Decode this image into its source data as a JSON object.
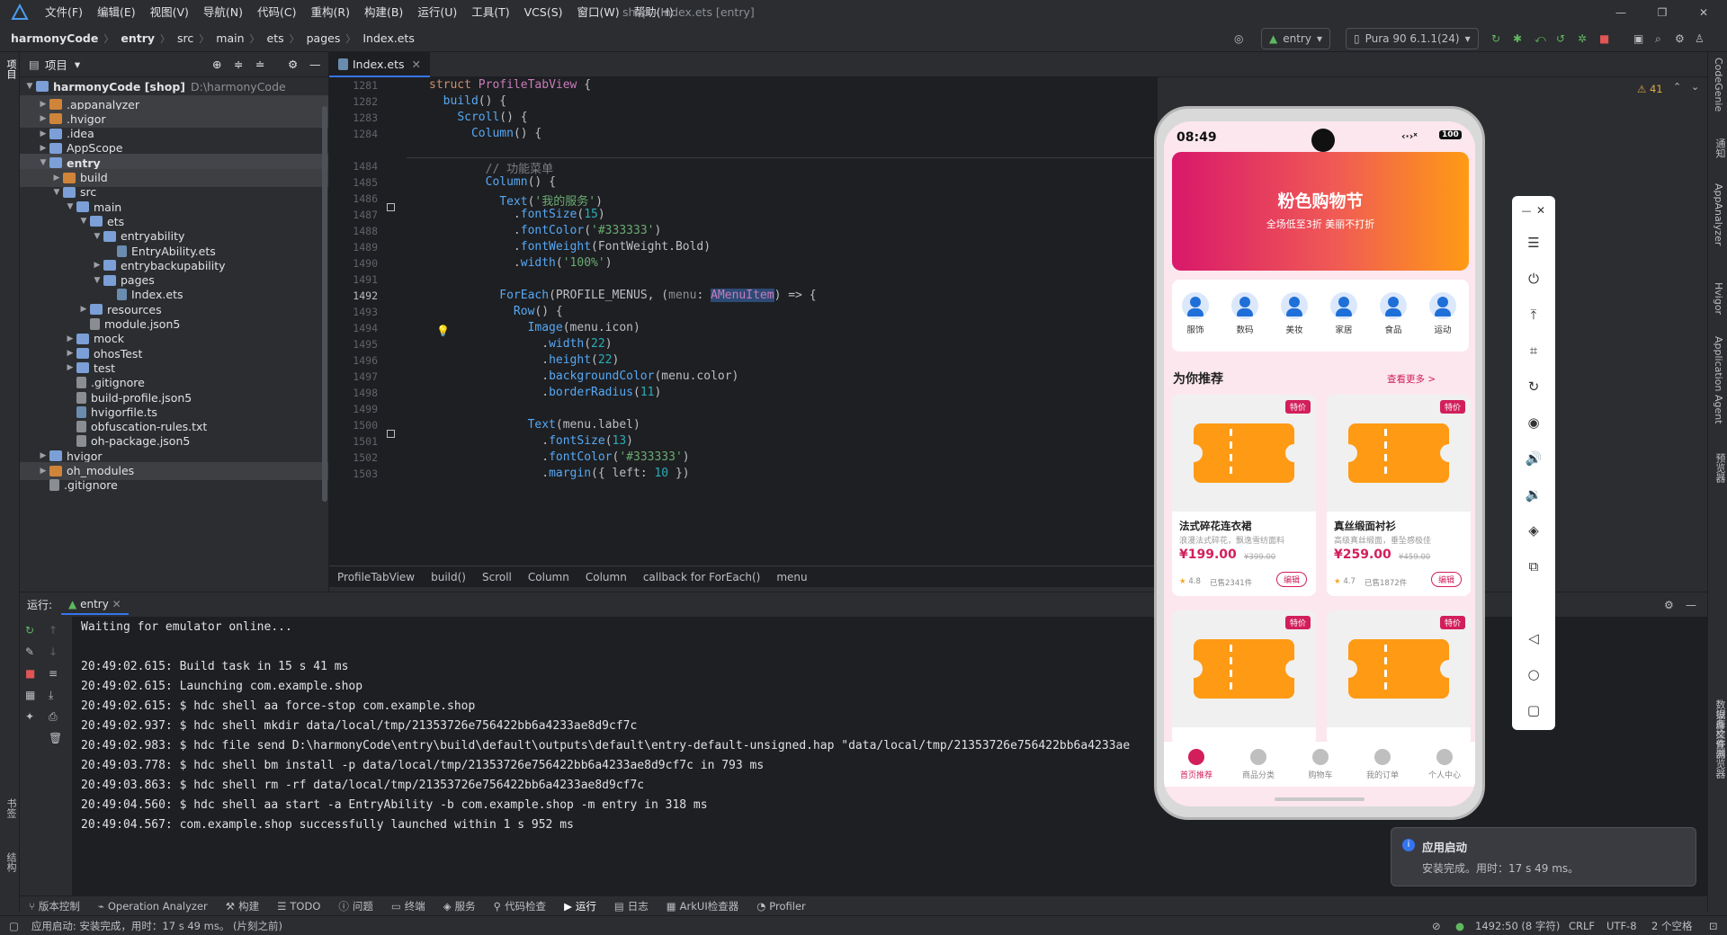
{
  "menubar": {
    "items": [
      "文件(F)",
      "编辑(E)",
      "视图(V)",
      "导航(N)",
      "代码(C)",
      "重构(R)",
      "构建(B)",
      "运行(U)",
      "工具(T)",
      "VCS(S)",
      "窗口(W)",
      "帮助(H)"
    ],
    "window_title": "shop - Index.ets [entry]"
  },
  "navbar": {
    "breadcrumbs": [
      "harmonyCode",
      "entry",
      "src",
      "main",
      "ets",
      "pages",
      "Index.ets"
    ],
    "run_config": "entry",
    "device": "Pura 90 6.1.1(24)"
  },
  "project": {
    "header": "项目",
    "root_name": "harmonyCode [shop]",
    "root_path": "D:\\harmonyCode",
    "tree": [
      {
        "label": ".appanalyzer",
        "depth": 1,
        "kind": "folder-o",
        "arrow": "▶"
      },
      {
        "label": ".hvigor",
        "depth": 1,
        "kind": "folder-o",
        "arrow": "▶"
      },
      {
        "label": ".idea",
        "depth": 1,
        "kind": "folder",
        "arrow": "▶"
      },
      {
        "label": "AppScope",
        "depth": 1,
        "kind": "folder",
        "arrow": "▶"
      },
      {
        "label": "entry",
        "depth": 1,
        "kind": "folder",
        "arrow": "▼",
        "bold": true
      },
      {
        "label": "build",
        "depth": 2,
        "kind": "folder-o",
        "arrow": "▶"
      },
      {
        "label": "src",
        "depth": 2,
        "kind": "folder",
        "arrow": "▼"
      },
      {
        "label": "main",
        "depth": 3,
        "kind": "folder",
        "arrow": "▼"
      },
      {
        "label": "ets",
        "depth": 4,
        "kind": "folder",
        "arrow": "▼"
      },
      {
        "label": "entryability",
        "depth": 5,
        "kind": "folder",
        "arrow": "▼"
      },
      {
        "label": "EntryAbility.ets",
        "depth": 6,
        "kind": "file",
        "arrow": ""
      },
      {
        "label": "entrybackupability",
        "depth": 5,
        "kind": "folder",
        "arrow": "▶"
      },
      {
        "label": "pages",
        "depth": 5,
        "kind": "folder",
        "arrow": "▼"
      },
      {
        "label": "Index.ets",
        "depth": 6,
        "kind": "file",
        "arrow": ""
      },
      {
        "label": "resources",
        "depth": 4,
        "kind": "folder",
        "arrow": "▶"
      },
      {
        "label": "module.json5",
        "depth": 4,
        "kind": "fgray",
        "arrow": ""
      },
      {
        "label": "mock",
        "depth": 3,
        "kind": "folder",
        "arrow": "▶"
      },
      {
        "label": "ohosTest",
        "depth": 3,
        "kind": "folder",
        "arrow": "▶"
      },
      {
        "label": "test",
        "depth": 3,
        "kind": "folder",
        "arrow": "▶"
      },
      {
        "label": ".gitignore",
        "depth": 3,
        "kind": "fgray",
        "arrow": ""
      },
      {
        "label": "build-profile.json5",
        "depth": 3,
        "kind": "fgray",
        "arrow": ""
      },
      {
        "label": "hvigorfile.ts",
        "depth": 3,
        "kind": "file",
        "arrow": ""
      },
      {
        "label": "obfuscation-rules.txt",
        "depth": 3,
        "kind": "fgray",
        "arrow": ""
      },
      {
        "label": "oh-package.json5",
        "depth": 3,
        "kind": "fgray",
        "arrow": ""
      },
      {
        "label": "hvigor",
        "depth": 1,
        "kind": "folder",
        "arrow": "▶"
      },
      {
        "label": "oh_modules",
        "depth": 1,
        "kind": "folder-o",
        "arrow": "▶"
      },
      {
        "label": ".gitignore",
        "depth": 1,
        "kind": "fgray",
        "arrow": ""
      }
    ]
  },
  "editor": {
    "tab": "Index.ets",
    "warning_count": "41",
    "sticky": [
      {
        "n": "1281",
        "html": "<span class=\"kw\">struct</span> <span class=\"ty\">ProfileTabView</span> {"
      },
      {
        "n": "1282",
        "html": "  <span class=\"fn\">build</span>() {"
      },
      {
        "n": "1283",
        "html": "    <span class=\"fn\">Scroll</span>() {"
      },
      {
        "n": "1284",
        "html": "      <span class=\"fn\">Column</span>() {"
      }
    ],
    "lines": [
      {
        "n": "1484",
        "html": "        <span class=\"cm\">// 功能菜单</span>"
      },
      {
        "n": "1485",
        "html": "        <span class=\"fn\">Column</span>() {"
      },
      {
        "n": "1486",
        "html": "          <span class=\"fn\">Text</span>(<span class=\"str\">'我的服务'</span>)"
      },
      {
        "n": "1487",
        "html": "            .<span class=\"fn\">fontSize</span>(<span class=\"num\">15</span>)"
      },
      {
        "n": "1488",
        "html": "            .<span class=\"fn\">fontColor</span>(<span class=\"str\">'#333333'</span>)"
      },
      {
        "n": "1489",
        "html": "            .<span class=\"fn\">fontWeight</span>(FontWeight.Bold)"
      },
      {
        "n": "1490",
        "html": "            .<span class=\"fn\">width</span>(<span class=\"str\">'100%'</span>)"
      },
      {
        "n": "1491",
        "html": ""
      },
      {
        "n": "1492",
        "html": "          <span class=\"fn\">ForEach</span>(PROFILE_MENUS, (<span class=\"par\">menu</span>: <span class=\"hlid\">AMenuItem</span>) => {"
      },
      {
        "n": "1493",
        "html": "            <span class=\"fn\">Row</span>() {"
      },
      {
        "n": "1494",
        "html": "              <span class=\"fn\">Image</span>(menu.icon)"
      },
      {
        "n": "1495",
        "html": "                .<span class=\"fn\">width</span>(<span class=\"num\">22</span>)"
      },
      {
        "n": "1496",
        "html": "                .<span class=\"fn\">height</span>(<span class=\"num\">22</span>)"
      },
      {
        "n": "1497",
        "html": "                .<span class=\"fn\">backgroundColor</span>(menu.color)"
      },
      {
        "n": "1498",
        "html": "                .<span class=\"fn\">borderRadius</span>(<span class=\"num\">11</span>)"
      },
      {
        "n": "1499",
        "html": ""
      },
      {
        "n": "1500",
        "html": "              <span class=\"fn\">Text</span>(menu.label)"
      },
      {
        "n": "1501",
        "html": "                .<span class=\"fn\">fontSize</span>(<span class=\"num\">13</span>)"
      },
      {
        "n": "1502",
        "html": "                .<span class=\"fn\">fontColor</span>(<span class=\"str\">'#333333'</span>)"
      },
      {
        "n": "1503",
        "html": "                .<span class=\"fn\">margin</span>({ left: <span class=\"num\">10</span> })"
      }
    ],
    "breadcrumb": [
      "ProfileTabView",
      "build()",
      "Scroll",
      "Column",
      "Column",
      "callback for ForEach()",
      "menu"
    ]
  },
  "run": {
    "label": "运行:",
    "tab": "entry",
    "lines": [
      "Waiting for emulator online...",
      "",
      "20:49:02.615: Build task in 15 s 41 ms",
      "20:49:02.615: Launching com.example.shop",
      "20:49:02.615: $ hdc shell aa force-stop com.example.shop",
      "20:49:02.937: $ hdc shell mkdir data/local/tmp/21353726e756422bb6a4233ae8d9cf7c",
      "20:49:02.983: $ hdc file send D:\\harmonyCode\\entry\\build\\default\\outputs\\default\\entry-default-unsigned.hap \"data/local/tmp/21353726e756422bb6a4233ae",
      "20:49:03.778: $ hdc shell bm install -p data/local/tmp/21353726e756422bb6a4233ae8d9cf7c in 793 ms",
      "20:49:03.863: $ hdc shell rm -rf data/local/tmp/21353726e756422bb6a4233ae8d9cf7c",
      "20:49:04.560: $ hdc shell aa start -a EntryAbility -b com.example.shop -m entry in 318 ms",
      "20:49:04.567: com.example.shop successfully launched within 1 s 952 ms"
    ]
  },
  "bottom_tools": [
    "版本控制",
    "Operation Analyzer",
    "构建",
    "TODO",
    "问题",
    "终端",
    "服务",
    "代码检查",
    "运行",
    "日志",
    "ArkUI检查器",
    "Profiler"
  ],
  "status": {
    "message": "应用启动: 安装完成，用时：17 s 49 ms。 (片刻之前)",
    "position": "1492:50 (8 字符)",
    "line_sep": "CRLF",
    "encoding": "UTF-8",
    "indent": "2 个空格"
  },
  "right_strip": [
    "CodeGenie",
    "通知",
    "AppAnalyzer",
    "Hvigor",
    "Application Agent",
    "预览器",
    "数据库检查器",
    "设备文件浏览器"
  ],
  "left_strip": [
    "项目",
    "书签",
    "结构"
  ],
  "phone": {
    "time": "08:49",
    "battery": "100",
    "banner_title": "粉色购物节",
    "banner_sub": "全场低至3折 美丽不打折",
    "categories": [
      "服饰",
      "数码",
      "美妆",
      "家居",
      "食品",
      "运动"
    ],
    "section_title": "为你推荐",
    "section_more": "查看更多 >",
    "badge": "特价",
    "products": [
      {
        "name": "法式碎花连衣裙",
        "desc": "浪漫法式碎花，飘逸雪纺面料",
        "price": "¥199.00",
        "old": "¥399.00",
        "rating": "4.8",
        "sold": "已售2341件",
        "edit": "编辑"
      },
      {
        "name": "真丝缎面衬衫",
        "desc": "高级真丝缎面，垂坠感极佳",
        "price": "¥259.00",
        "old": "¥459.00",
        "rating": "4.7",
        "sold": "已售1872件",
        "edit": "编辑"
      }
    ],
    "tabs": [
      "首页推荐",
      "商品分类",
      "购物车",
      "我的订单",
      "个人中心"
    ]
  },
  "toast": {
    "title": "应用启动",
    "body": "安装完成。用时：17 s 49 ms。"
  },
  "colors": {
    "accent": "#3574f0",
    "brand_pink": "#d21f5c",
    "ticket": "#ff9a14"
  }
}
